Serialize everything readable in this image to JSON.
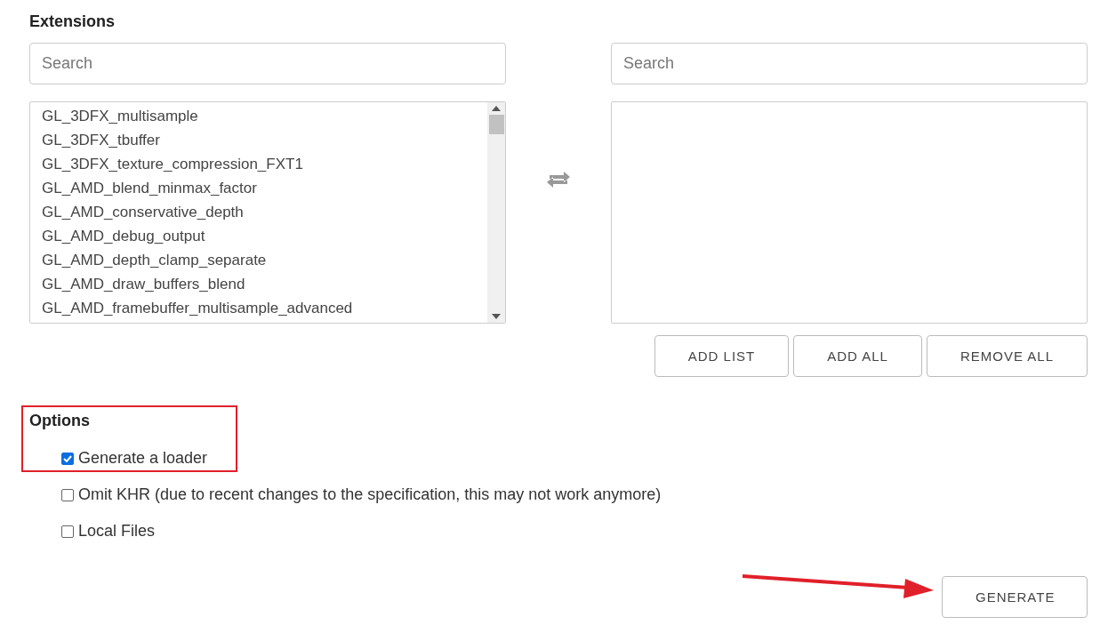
{
  "extensions": {
    "title": "Extensions",
    "available": {
      "search": {
        "placeholder": "Search"
      },
      "items": [
        "GL_3DFX_multisample",
        "GL_3DFX_tbuffer",
        "GL_3DFX_texture_compression_FXT1",
        "GL_AMD_blend_minmax_factor",
        "GL_AMD_conservative_depth",
        "GL_AMD_debug_output",
        "GL_AMD_depth_clamp_separate",
        "GL_AMD_draw_buffers_blend",
        "GL_AMD_framebuffer_multisample_advanced"
      ]
    },
    "selected": {
      "search": {
        "placeholder": "Search"
      }
    },
    "buttons": [
      "ADD LIST",
      "ADD ALL",
      "REMOVE ALL"
    ]
  },
  "options": {
    "title": "Options",
    "highlighted": true,
    "items": [
      {
        "label": "Generate a loader",
        "checked": true
      },
      {
        "label": "Omit KHR (due to recent changes to the specification, this may not work anymore)",
        "checked": false
      },
      {
        "label": "Local Files",
        "checked": false
      }
    ]
  },
  "generate_button": {
    "label": "GENERATE",
    "annotated": true
  }
}
